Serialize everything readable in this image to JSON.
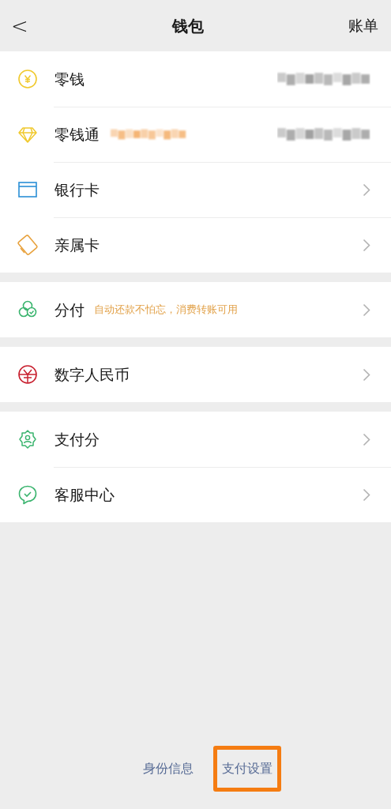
{
  "header": {
    "back": "<",
    "title": "钱包",
    "action": "账单"
  },
  "groups": [
    {
      "items": [
        {
          "label": "零钱",
          "kind": "balance",
          "tag_blurred": false
        },
        {
          "label": "零钱通",
          "kind": "balance",
          "tag_blurred": true
        },
        {
          "label": "银行卡",
          "kind": "link"
        },
        {
          "label": "亲属卡",
          "kind": "link"
        }
      ]
    },
    {
      "items": [
        {
          "label": "分付",
          "note": "自动还款不怕忘，消费转账可用",
          "kind": "link"
        }
      ]
    },
    {
      "items": [
        {
          "label": "数字人民币",
          "kind": "link"
        }
      ]
    },
    {
      "items": [
        {
          "label": "支付分",
          "kind": "link"
        },
        {
          "label": "客服中心",
          "kind": "link"
        }
      ]
    }
  ],
  "footer_links": [
    {
      "label": "身份信息",
      "highlighted": false
    },
    {
      "label": "支付设置",
      "highlighted": true
    }
  ]
}
